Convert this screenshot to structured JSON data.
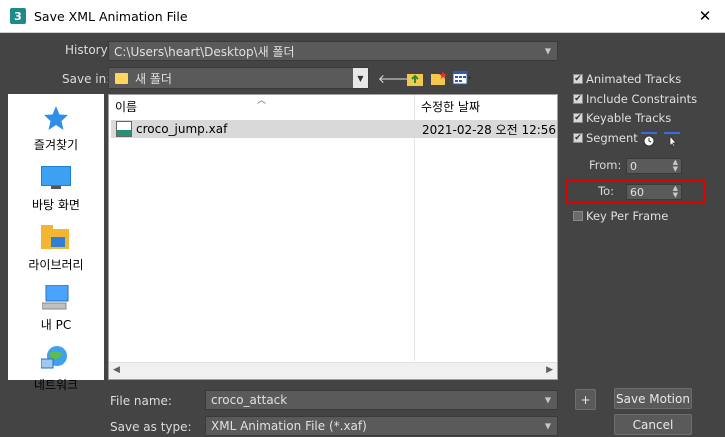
{
  "window": {
    "title": "Save XML Animation File",
    "app_icon": "3",
    "close_glyph": "✕"
  },
  "history": {
    "label": "History:",
    "value": "C:\\Users\\heart\\Desktop\\새 폴더"
  },
  "save_in": {
    "label": "Save in:",
    "value": "새 폴더"
  },
  "places": [
    {
      "label": "즐겨찾기",
      "icon": "star-icon"
    },
    {
      "label": "바탕 화면",
      "icon": "desktop-icon"
    },
    {
      "label": "라이브러리",
      "icon": "library-icon"
    },
    {
      "label": "내 PC",
      "icon": "pc-icon"
    },
    {
      "label": "네트워크",
      "icon": "network-icon"
    }
  ],
  "filelist": {
    "columns": [
      "이름",
      "수정한 날짜"
    ],
    "rows": [
      {
        "name": "croco_jump.xaf",
        "date": "2021-02-28 오전 12:56"
      }
    ]
  },
  "file_name": {
    "label": "File name:",
    "value": "croco_attack"
  },
  "save_as_type": {
    "label": "Save as type:",
    "value": "XML Animation File (*.xaf)"
  },
  "options": {
    "animated_tracks": {
      "label": "Animated Tracks",
      "checked": true
    },
    "include_constraints": {
      "label": "Include Constraints",
      "checked": true
    },
    "keyable_tracks": {
      "label": "Keyable Tracks",
      "checked": true
    },
    "segment": {
      "label": "Segment",
      "checked": true
    },
    "from": {
      "label": "From:",
      "value": "0"
    },
    "to": {
      "label": "To:",
      "value": "60"
    },
    "key_per_frame": {
      "label": "Key Per Frame",
      "checked": false
    }
  },
  "buttons": {
    "plus": "+",
    "save_motion": "Save Motion",
    "cancel": "Cancel"
  },
  "colors": {
    "dialog_bg": "#444444",
    "highlight": "#e00000",
    "selected_row": "#d9d9d9"
  }
}
